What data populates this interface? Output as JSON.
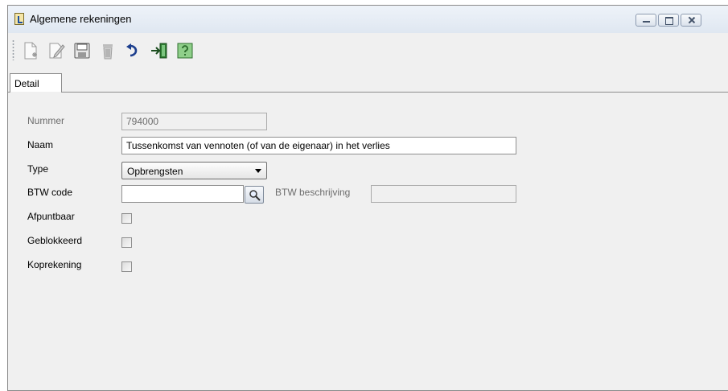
{
  "window": {
    "title": "Algemene rekeningen"
  },
  "toolbar": {
    "buttons": [
      {
        "name": "new-record-icon"
      },
      {
        "name": "edit-record-icon"
      },
      {
        "name": "save-icon"
      },
      {
        "name": "delete-icon"
      },
      {
        "name": "undo-icon"
      },
      {
        "name": "exit-icon"
      },
      {
        "name": "help-icon"
      }
    ]
  },
  "tabs": [
    {
      "label": "Detail",
      "active": true
    }
  ],
  "form": {
    "nummer": {
      "label": "Nummer",
      "value": "794000",
      "enabled": false
    },
    "naam": {
      "label": "Naam",
      "value": "Tussenkomst van vennoten (of van de eigenaar) in het verlies"
    },
    "type": {
      "label": "Type",
      "value": "Opbrengsten"
    },
    "btw_code": {
      "label": "BTW code",
      "value": ""
    },
    "btw_beschrijving": {
      "label": "BTW beschrijving",
      "value": "",
      "enabled": false
    },
    "afpuntbaar": {
      "label": "Afpuntbaar",
      "checked": false
    },
    "geblokkeerd": {
      "label": "Geblokkeerd",
      "checked": false
    },
    "koprekening": {
      "label": "Koprekening",
      "checked": false
    }
  },
  "colors": {
    "window_bg": "#f0f0f0",
    "title_gradient_top": "#eef3f9",
    "disabled_text": "#6d6d6d"
  }
}
